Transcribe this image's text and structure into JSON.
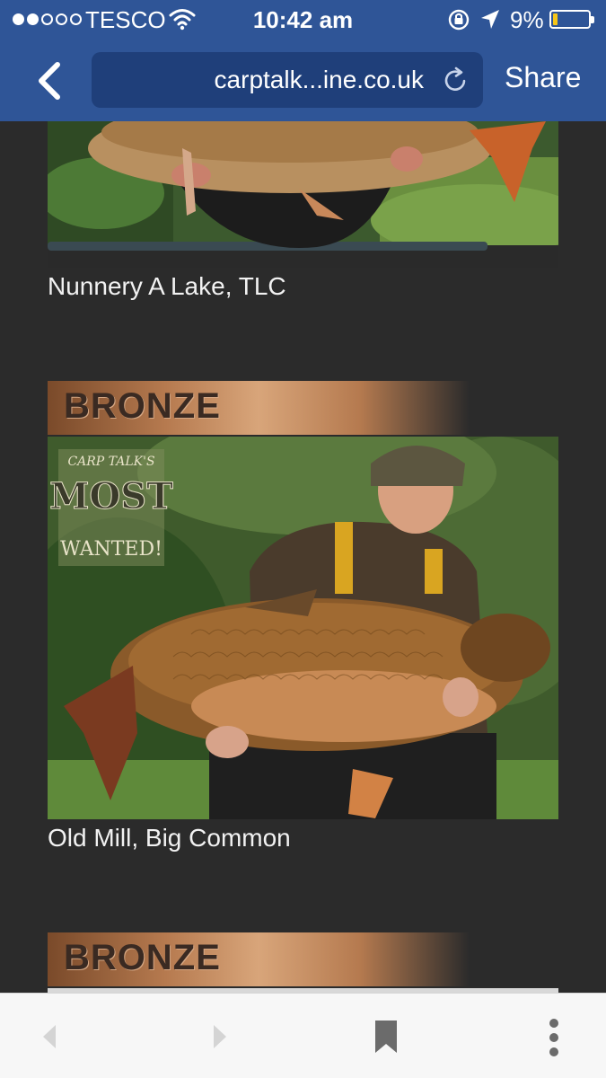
{
  "status_bar": {
    "carrier": "TESCO",
    "time": "10:42 am",
    "battery_percent": "9%",
    "battery_level": 0.09,
    "signal_bars_filled": 2,
    "signal_bars_total": 5
  },
  "nav": {
    "url": "carptalk...ine.co.uk",
    "share_label": "Share"
  },
  "content": {
    "entries": [
      {
        "caption": "Nunnery A Lake, TLC"
      },
      {
        "badge": "BRONZE",
        "caption": "Old Mill, Big Common",
        "photo_overlay": {
          "line1": "CARP TALK'S",
          "line2": "MOST",
          "line3": "WANTED!"
        }
      },
      {
        "badge": "BRONZE"
      }
    ]
  },
  "colors": {
    "nav_bar": "#2f5597",
    "url_field": "#1f3f7a",
    "page_background": "#2b2b2b",
    "bronze_banner": "#b67a4f",
    "toolbar": "#f7f7f7"
  },
  "icons": [
    "wifi-icon",
    "rotation-lock-icon",
    "location-arrow-icon",
    "back-chevron-icon",
    "reload-icon",
    "prev-arrow-icon",
    "next-arrow-icon",
    "bookmark-icon",
    "more-options-icon"
  ]
}
